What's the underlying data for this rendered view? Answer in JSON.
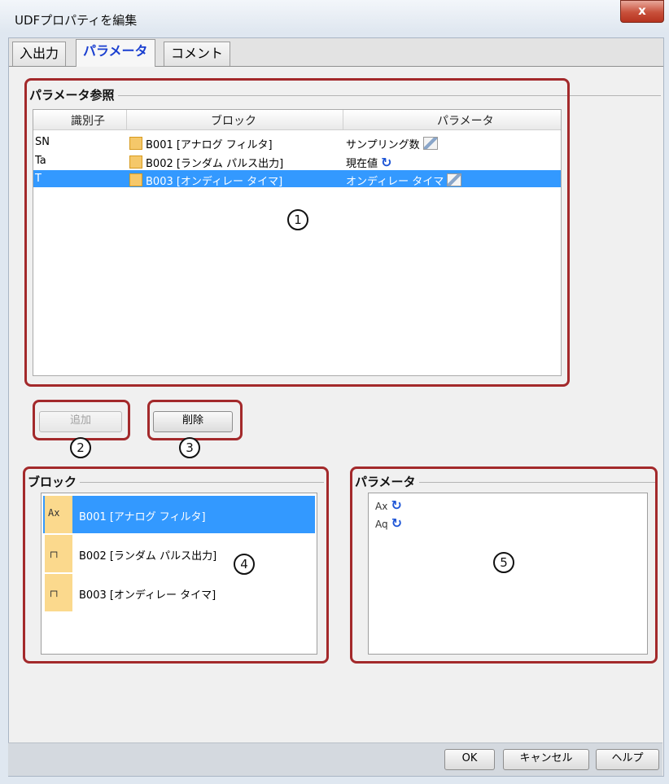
{
  "window": {
    "title": "UDFプロパティを編集",
    "close_label": "x"
  },
  "tabs": [
    {
      "label": "入出力"
    },
    {
      "label": "パラメータ"
    },
    {
      "label": "コメント"
    }
  ],
  "param_ref": {
    "group_label": "パラメータ参照",
    "headers": [
      "識別子",
      "ブロック",
      "パラメータ"
    ],
    "rows": [
      {
        "id": "SN",
        "block": "B001 [アナログ フィルタ]",
        "param": "サンプリング数",
        "param_icon": "edit-icon"
      },
      {
        "id": "Ta",
        "block": "B002 [ランダム パルス出力]",
        "param": "現在値",
        "param_icon": "refresh-icon"
      },
      {
        "id": "T",
        "block": "B003 [オンディレー タイマ]",
        "param": "オンディレー タイマ",
        "param_icon": "edit-icon"
      }
    ]
  },
  "buttons": {
    "add": "追加",
    "delete": "削除",
    "ok": "OK",
    "cancel": "キャンセル",
    "help": "ヘルプ"
  },
  "block_group": {
    "label": "ブロック",
    "items": [
      {
        "icon_text": "Ax",
        "label": "B001 [アナログ フィルタ]"
      },
      {
        "icon_text": "┌┐",
        "label": "B002 [ランダム パルス出力]"
      },
      {
        "icon_text": "┌┐",
        "label": "B003 [オンディレー タイマ]"
      }
    ]
  },
  "param_group": {
    "label": "パラメータ",
    "items": [
      {
        "label": "Ax"
      },
      {
        "label": "Aq"
      }
    ]
  },
  "markers": [
    "1",
    "2",
    "3",
    "4",
    "5"
  ],
  "colors": {
    "highlight": "#3399ff",
    "annotation": "#a3292b",
    "tab_active": "#1a3fd0"
  }
}
